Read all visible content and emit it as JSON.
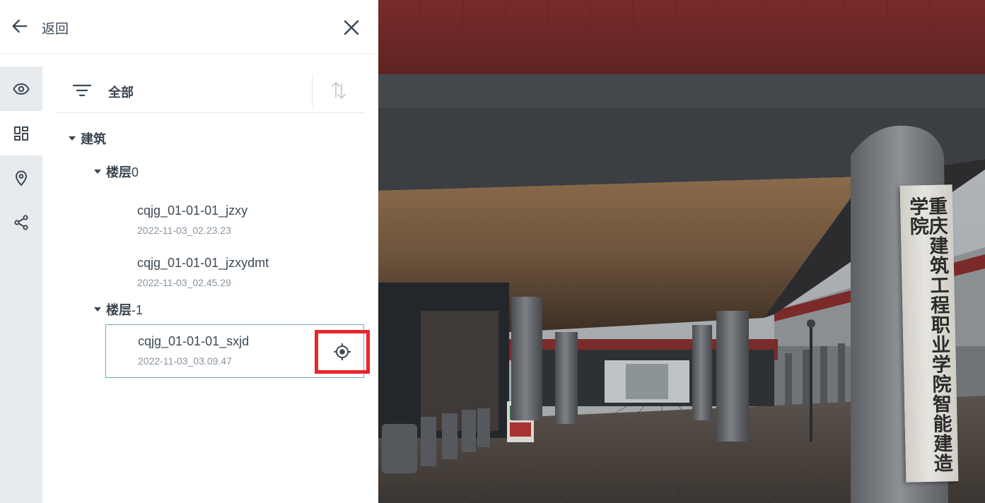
{
  "header": {
    "back_label": "返回"
  },
  "toolbar": {
    "filter_label": "全部"
  },
  "rail": {
    "items": [
      {
        "icon": "eye-icon",
        "active": false
      },
      {
        "icon": "layers-grid-icon",
        "active": true
      },
      {
        "icon": "map-pin-icon",
        "active": false
      },
      {
        "icon": "share-icon",
        "active": false
      }
    ]
  },
  "tree": {
    "root_label": "建筑",
    "groups": [
      {
        "label_prefix": "楼层",
        "label_num": "0",
        "items": [
          {
            "name": "cqjg_01-01-01_jzxy",
            "time": "2022-11-03_02.23.23"
          },
          {
            "name": "cqjg_01-01-01_jzxydmt",
            "time": "2022-11-03_02.45.29"
          }
        ]
      },
      {
        "label_prefix": "楼层",
        "label_num": "-1",
        "items": [
          {
            "name": "cqjg_01-01-01_sxjd",
            "time": "2022-11-03_03.09.47",
            "selected": true
          }
        ]
      }
    ]
  },
  "photo": {
    "sign_text": "重庆建筑工程职业学院智能建造学院"
  },
  "colors": {
    "accent_red": "#e8262b",
    "selected_border": "#6aa6c8",
    "rail_bg": "#e8ebee",
    "text_dark": "#3a4550"
  }
}
